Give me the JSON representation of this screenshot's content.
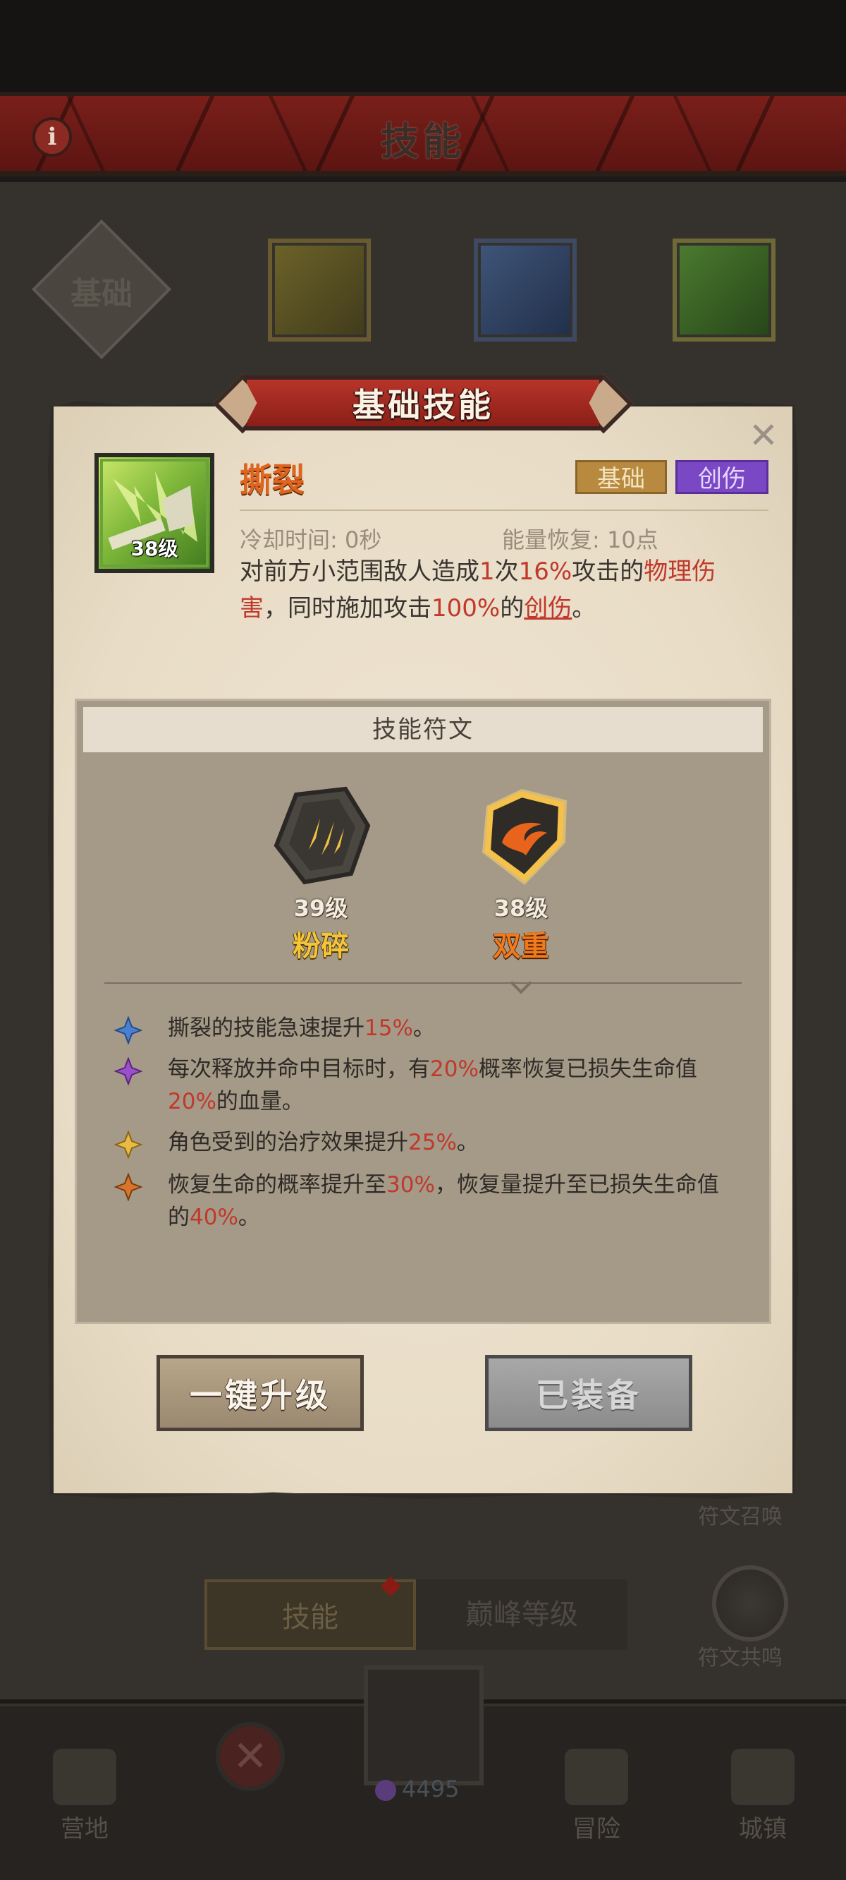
{
  "header": {
    "title": "技能",
    "info_glyph": "i"
  },
  "tabs": {
    "basic_label": "基础"
  },
  "dialog": {
    "banner_title": "基础技能",
    "close_glyph": "✕",
    "skill": {
      "name": "撕裂",
      "level": "38级",
      "tags": [
        "基础",
        "创伤"
      ],
      "cooldown": "冷却时间: 0秒",
      "energy": "能量恢复: 10点",
      "description": {
        "p1": "对前方小范围敌人造成",
        "v1": "1",
        "p2": "次",
        "v2": "16%",
        "p3": "攻击的",
        "v3": "物理伤害",
        "p4": "，同时施加攻击",
        "v4": "100%",
        "p5": "的",
        "v5": "创伤",
        "p6": "。"
      }
    },
    "runes": {
      "title": "技能符文",
      "items": [
        {
          "level": "39级",
          "name": "粉碎"
        },
        {
          "level": "38级",
          "name": "双重"
        }
      ],
      "effects": [
        {
          "color": "#4a7fd0",
          "pre": "撕裂的技能急速提升",
          "val": "15%",
          "post": "。"
        },
        {
          "color": "#9b4fc8",
          "pre": "每次释放并命中目标时，有",
          "val": "20%",
          "mid": "概率恢复已损失生命值",
          "val2": "20%",
          "post": "的血量。"
        },
        {
          "color": "#e0b030",
          "pre": "角色受到的治疗效果提升",
          "val": "25%",
          "post": "。"
        },
        {
          "color": "#d8752a",
          "pre": "恢复生命的概率提升至",
          "val": "30%",
          "mid": "，恢复量提升至已损失生命值的",
          "val2": "40%",
          "post": "。"
        }
      ]
    },
    "buttons": {
      "upgrade": "一键升级",
      "equipped": "已装备"
    }
  },
  "side": {
    "rune_summon": "符文召唤",
    "rune_resonance": "符文共鸣"
  },
  "bottom_tabs": {
    "skill": "技能",
    "peak": "巅峰等级"
  },
  "nav": {
    "camp": "营地",
    "adventure": "冒险",
    "town": "城镇",
    "currency": "4495"
  }
}
